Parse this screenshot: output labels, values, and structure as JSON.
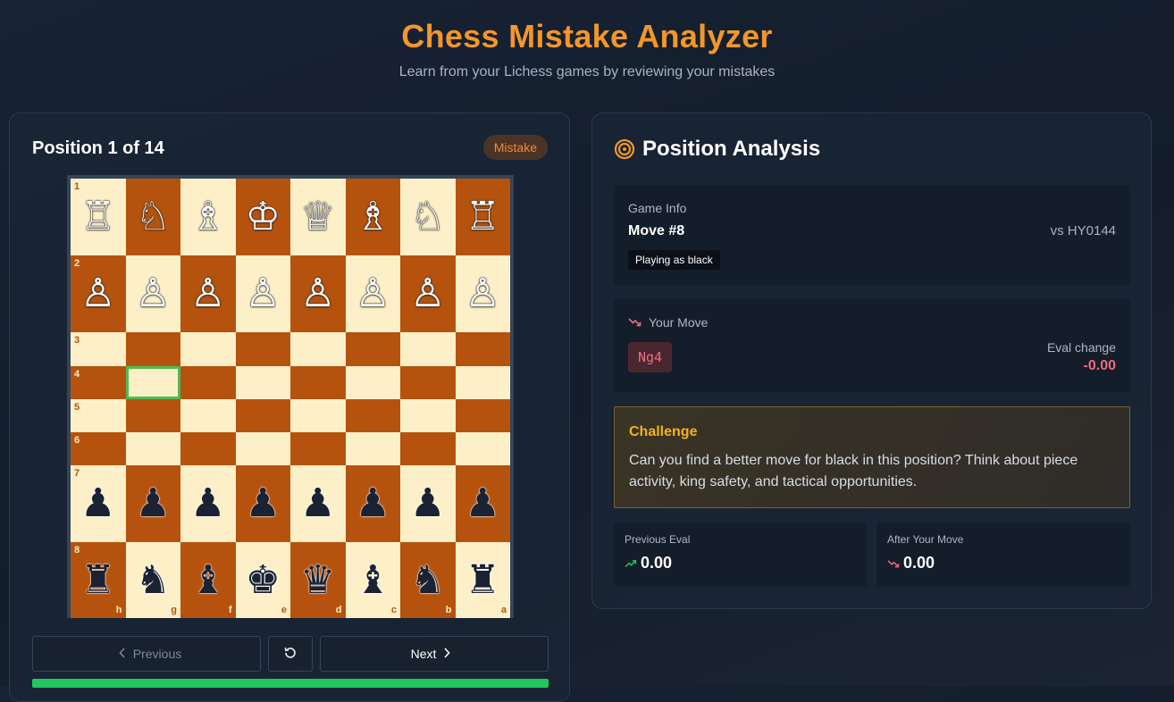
{
  "header": {
    "title": "Chess Mistake Analyzer",
    "subtitle": "Learn from your Lichess games by reviewing your mistakes"
  },
  "board_panel": {
    "position_label": "Position 1 of 14",
    "badge": "Mistake",
    "board": {
      "orientation": "black",
      "rows": [
        [
          {
            "p": "♖",
            "c": "w"
          },
          {
            "p": "♘",
            "c": "w"
          },
          {
            "p": "♗",
            "c": "w"
          },
          {
            "p": "♔",
            "c": "w"
          },
          {
            "p": "♕",
            "c": "w"
          },
          {
            "p": "♗",
            "c": "w"
          },
          {
            "p": "♘",
            "c": "w"
          },
          {
            "p": "♖",
            "c": "w"
          }
        ],
        [
          {
            "p": "♙",
            "c": "w"
          },
          {
            "p": "♙",
            "c": "w"
          },
          {
            "p": "♙",
            "c": "w"
          },
          {
            "p": "♙",
            "c": "w"
          },
          {
            "p": "♙",
            "c": "w"
          },
          {
            "p": "♙",
            "c": "w"
          },
          {
            "p": "♙",
            "c": "w"
          },
          {
            "p": "♙",
            "c": "w"
          }
        ],
        [
          null,
          null,
          null,
          null,
          null,
          null,
          null,
          null
        ],
        [
          null,
          null,
          null,
          null,
          null,
          null,
          null,
          null
        ],
        [
          null,
          null,
          null,
          null,
          null,
          null,
          null,
          null
        ],
        [
          null,
          null,
          null,
          null,
          null,
          null,
          null,
          null
        ],
        [
          {
            "p": "♟",
            "c": "b"
          },
          {
            "p": "♟",
            "c": "b"
          },
          {
            "p": "♟",
            "c": "b"
          },
          {
            "p": "♟",
            "c": "b"
          },
          {
            "p": "♟",
            "c": "b"
          },
          {
            "p": "♟",
            "c": "b"
          },
          {
            "p": "♟",
            "c": "b"
          },
          {
            "p": "♟",
            "c": "b"
          }
        ],
        [
          {
            "p": "♜",
            "c": "b"
          },
          {
            "p": "♞",
            "c": "b"
          },
          {
            "p": "♝",
            "c": "b"
          },
          {
            "p": "♚",
            "c": "b"
          },
          {
            "p": "♛",
            "c": "b"
          },
          {
            "p": "♝",
            "c": "b"
          },
          {
            "p": "♞",
            "c": "b"
          },
          {
            "p": "♜",
            "c": "b"
          }
        ]
      ],
      "rank_labels": [
        "1",
        "2",
        "3",
        "4",
        "5",
        "6",
        "7",
        "8"
      ],
      "file_labels": [
        "h",
        "g",
        "f",
        "e",
        "d",
        "c",
        "b",
        "a"
      ],
      "highlight_square": "g4",
      "light_color": "#fdf0c8",
      "dark_color": "#b5530e"
    },
    "controls": {
      "previous_label": "Previous",
      "next_label": "Next",
      "reset_icon": "rotate-ccw-icon"
    },
    "progress": 1.0
  },
  "analysis": {
    "title": "Position Analysis",
    "game_info": {
      "label": "Game Info",
      "move": "Move #8",
      "opponent": "vs HY0144",
      "playing_as": "Playing as black"
    },
    "your_move": {
      "label": "Your Move",
      "move": "Ng4",
      "eval_change_label": "Eval change",
      "eval_change": "-0.00"
    },
    "challenge": {
      "title": "Challenge",
      "text": "Can you find a better move for black in this position? Think about piece activity, king safety, and tactical opportunities."
    },
    "previous_eval": {
      "label": "Previous Eval",
      "value": "0.00"
    },
    "after_move": {
      "label": "After Your Move",
      "value": "0.00"
    }
  },
  "colors": {
    "accent": "#f3962b",
    "mistake": "#f08a3c",
    "negative": "#ef6b7c",
    "positive": "#22c55e",
    "challenge": "#f3b21f"
  }
}
